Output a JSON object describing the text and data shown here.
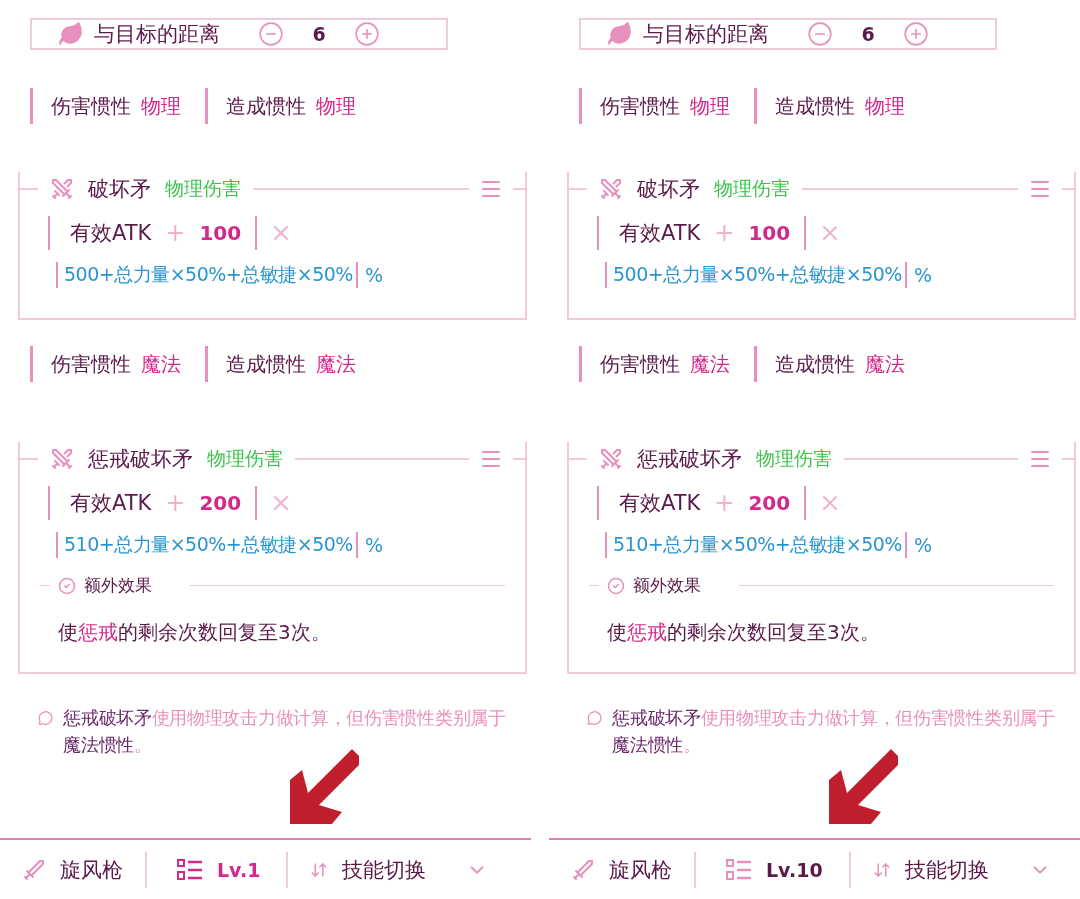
{
  "panels": [
    {
      "distance": {
        "label": "与目标的距离",
        "value": "6"
      },
      "sections": [
        {
          "inertia": [
            {
              "label": "伤害惯性",
              "value": "物理"
            },
            {
              "label": "造成惯性",
              "value": "物理"
            }
          ],
          "card": {
            "name": "破坏矛",
            "damage_type": "物理伤害",
            "atk_label": "有效ATK",
            "plus": "+",
            "atk_value": "100",
            "formula": "500+总力量×50%+总敏捷×50%",
            "unit": "%"
          }
        },
        {
          "inertia": [
            {
              "label": "伤害惯性",
              "value": "魔法"
            },
            {
              "label": "造成惯性",
              "value": "魔法"
            }
          ],
          "card": {
            "name": "惩戒破坏矛",
            "damage_type": "物理伤害",
            "atk_label": "有效ATK",
            "plus": "+",
            "atk_value": "200",
            "formula": "510+总力量×50%+总敏捷×50%",
            "unit": "%",
            "extra": {
              "title": "额外效果",
              "parts": [
                {
                  "text": "使",
                  "highlight": false
                },
                {
                  "text": "惩戒",
                  "highlight": true
                },
                {
                  "text": "的剩余次数回复至3次。",
                  "highlight": false
                }
              ]
            }
          }
        }
      ],
      "note": [
        {
          "text": "惩戒破坏矛",
          "highlight": true
        },
        {
          "text": "使用物理攻击力做计算，但伤害惯性类别属于",
          "highlight": false
        },
        {
          "text": "魔法惯性",
          "highlight": true
        },
        {
          "text": "。",
          "highlight": false
        }
      ],
      "bottom_bar": {
        "weapon": "旋风枪",
        "level": "Lv.1",
        "level_highlighted": true,
        "switch_label": "技能切换"
      }
    },
    {
      "distance": {
        "label": "与目标的距离",
        "value": "6"
      },
      "sections": [
        {
          "inertia": [
            {
              "label": "伤害惯性",
              "value": "物理"
            },
            {
              "label": "造成惯性",
              "value": "物理"
            }
          ],
          "card": {
            "name": "破坏矛",
            "damage_type": "物理伤害",
            "atk_label": "有效ATK",
            "plus": "+",
            "atk_value": "100",
            "formula": "500+总力量×50%+总敏捷×50%",
            "unit": "%"
          }
        },
        {
          "inertia": [
            {
              "label": "伤害惯性",
              "value": "魔法"
            },
            {
              "label": "造成惯性",
              "value": "魔法"
            }
          ],
          "card": {
            "name": "惩戒破坏矛",
            "damage_type": "物理伤害",
            "atk_label": "有效ATK",
            "plus": "+",
            "atk_value": "200",
            "formula": "510+总力量×50%+总敏捷×50%",
            "unit": "%",
            "extra": {
              "title": "额外效果",
              "parts": [
                {
                  "text": "使",
                  "highlight": false
                },
                {
                  "text": "惩戒",
                  "highlight": true
                },
                {
                  "text": "的剩余次数回复至3次。",
                  "highlight": false
                }
              ]
            }
          }
        }
      ],
      "note": [
        {
          "text": "惩戒破坏矛",
          "highlight": true
        },
        {
          "text": "使用物理攻击力做计算，但伤害惯性类别属于",
          "highlight": false
        },
        {
          "text": "魔法惯性",
          "highlight": true
        },
        {
          "text": "。",
          "highlight": false
        }
      ],
      "bottom_bar": {
        "weapon": "旋风枪",
        "level": "Lv.10",
        "level_highlighted": false,
        "switch_label": "技能切换"
      }
    }
  ]
}
